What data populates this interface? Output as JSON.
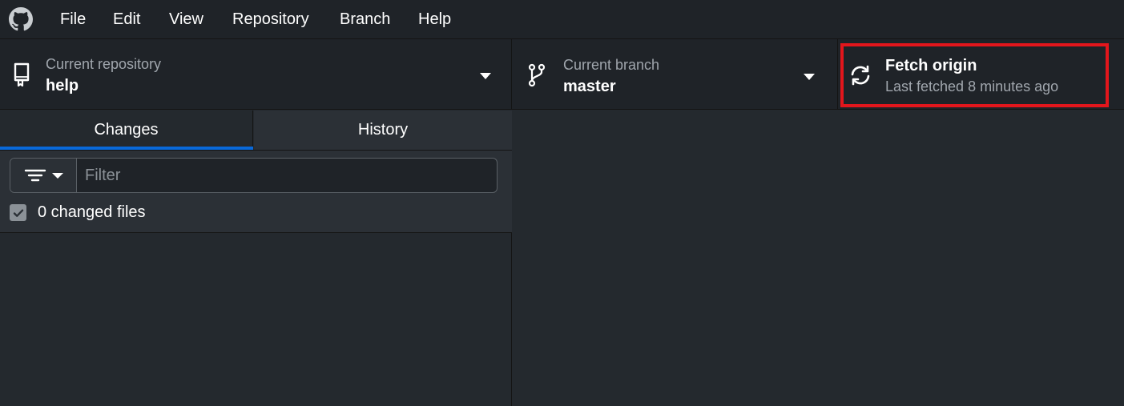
{
  "menu": [
    {
      "label": "File"
    },
    {
      "label": "Edit"
    },
    {
      "label": "View"
    },
    {
      "label": "Repository"
    },
    {
      "label": "Branch"
    },
    {
      "label": "Help"
    }
  ],
  "toolbar": {
    "repository": {
      "label": "Current repository",
      "value": "help",
      "icon": "repo-icon"
    },
    "branch": {
      "label": "Current branch",
      "value": "master",
      "icon": "git-branch-icon"
    },
    "fetch": {
      "title": "Fetch origin",
      "subtitle": "Last fetched 8 minutes ago",
      "icon": "sync-icon"
    }
  },
  "tabs": [
    {
      "label": "Changes",
      "selected": true
    },
    {
      "label": "History",
      "selected": false
    }
  ],
  "filter": {
    "placeholder": "Filter",
    "value": ""
  },
  "changes": {
    "summary": "0 changed files",
    "checked": true
  },
  "colors": {
    "highlight": "#e3161c",
    "accent": "#0969da",
    "background": "#24292e"
  }
}
